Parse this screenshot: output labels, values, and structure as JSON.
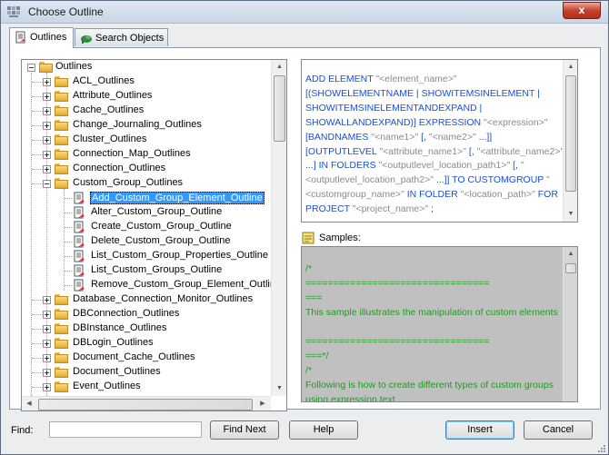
{
  "window": {
    "title": "Choose Outline",
    "close_glyph": "x"
  },
  "tabs": [
    {
      "label": "Outlines",
      "icon": "outline-doc-icon",
      "active": true
    },
    {
      "label": "Search Objects",
      "icon": "search-objects-icon",
      "active": false
    }
  ],
  "tree": {
    "root": "Outlines",
    "items": [
      {
        "label": "ACL_Outlines",
        "type": "folder"
      },
      {
        "label": "Attribute_Outlines",
        "type": "folder"
      },
      {
        "label": "Cache_Outlines",
        "type": "folder"
      },
      {
        "label": "Change_Journaling_Outlines",
        "type": "folder"
      },
      {
        "label": "Cluster_Outlines",
        "type": "folder"
      },
      {
        "label": "Connection_Map_Outlines",
        "type": "folder"
      },
      {
        "label": "Connection_Outlines",
        "type": "folder"
      },
      {
        "label": "Custom_Group_Outlines",
        "type": "folder",
        "expanded": true
      },
      {
        "label": "Add_Custom_Group_Element_Outline",
        "type": "doc",
        "selected": true
      },
      {
        "label": "Alter_Custom_Group_Outline",
        "type": "doc"
      },
      {
        "label": "Create_Custom_Group_Outline",
        "type": "doc"
      },
      {
        "label": "Delete_Custom_Group_Outline",
        "type": "doc"
      },
      {
        "label": "List_Custom_Group_Properties_Outline",
        "type": "doc"
      },
      {
        "label": "List_Custom_Groups_Outline",
        "type": "doc"
      },
      {
        "label": "Remove_Custom_Group_Element_Outline",
        "type": "doc"
      },
      {
        "label": "Database_Connection_Monitor_Outlines",
        "type": "folder"
      },
      {
        "label": "DBConnection_Outlines",
        "type": "folder"
      },
      {
        "label": "DBInstance_Outlines",
        "type": "folder"
      },
      {
        "label": "DBLogin_Outlines",
        "type": "folder"
      },
      {
        "label": "Document_Cache_Outlines",
        "type": "folder"
      },
      {
        "label": "Document_Outlines",
        "type": "folder"
      },
      {
        "label": "Event_Outlines",
        "type": "folder"
      }
    ]
  },
  "syntax": {
    "segments": [
      {
        "t": "ADD ELEMENT ",
        "c": "kw"
      },
      {
        "t": "\"<element_name>\"",
        "c": "g"
      },
      {
        "t": " [(SHOWELEMENTNAME | SHOWITEMSINELEMENT | SHOWITEMSINELEMENTANDEXPAND | SHOWALLANDEXPAND)] EXPRESSION ",
        "c": "kw"
      },
      {
        "t": "\"<expression>\"",
        "c": "g"
      },
      {
        "t": " [BANDNAMES ",
        "c": "kw"
      },
      {
        "t": "\"<name1>\"",
        "c": "g"
      },
      {
        "t": " [, ",
        "c": "kw"
      },
      {
        "t": "\"<name2>\"",
        "c": "g"
      },
      {
        "t": " ...]] [OUTPUTLEVEL ",
        "c": "kw"
      },
      {
        "t": "\"<attribute_name1>\"",
        "c": "g"
      },
      {
        "t": " [, ",
        "c": "kw"
      },
      {
        "t": "\"<attribute_name2>\"",
        "c": "g"
      },
      {
        "t": " ...] IN FOLDERS ",
        "c": "kw"
      },
      {
        "t": "\"<outputlevel_location_path1>\"",
        "c": "g"
      },
      {
        "t": " [, ",
        "c": "kw"
      },
      {
        "t": "\"<outputlevel_location_path2>\"",
        "c": "g"
      },
      {
        "t": " ...]] TO CUSTOMGROUP ",
        "c": "kw"
      },
      {
        "t": "\"<customgroup_name>\"",
        "c": "g"
      },
      {
        "t": " IN FOLDER ",
        "c": "kw"
      },
      {
        "t": "\"<location_path>\"",
        "c": "g"
      },
      {
        "t": " FOR PROJECT ",
        "c": "kw"
      },
      {
        "t": "\"<project_name>\"",
        "c": "g"
      },
      {
        "t": " ;",
        "c": "kw"
      }
    ]
  },
  "samples": {
    "label": "Samples:",
    "text": "/*\n=================================\n===\nThis sample illustrates the manipulation of custom elements\n\n=================================\n===*/\n/*\nFollowing is how to create different types of custom groups using expression text."
  },
  "bottom": {
    "find_label": "Find:",
    "find_value": "",
    "find_next": "Find Next",
    "help": "Help",
    "insert": "Insert",
    "cancel": "Cancel"
  },
  "colors": {
    "syntax_keyword": "#1a4fd8",
    "syntax_placeholder": "#8a8a8a",
    "samples_text": "#1e9e1e",
    "samples_bg": "#c0c0c0",
    "selection": "#3399ff"
  }
}
